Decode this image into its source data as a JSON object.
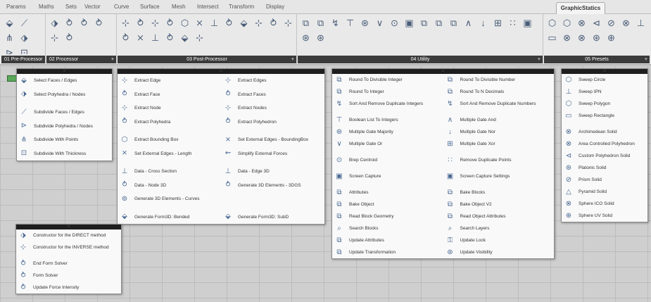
{
  "menubar": {
    "items": [
      "Params",
      "Maths",
      "Sets",
      "Vector",
      "Curve",
      "Surface",
      "Mesh",
      "Intersect",
      "Transform",
      "Display"
    ],
    "active_tab": "GraphicStatics"
  },
  "ribbon": {
    "groups": [
      {
        "label": "01 Pre-Processor",
        "icons": [
          "⬙",
          "⟋",
          "⋔",
          "⬗",
          "⊳",
          "⊡"
        ]
      },
      {
        "label": "02 Processor",
        "icons": [
          "⬗",
          "⥁",
          "⥁",
          "⥁",
          "⊹",
          "⥁"
        ]
      },
      {
        "label": "03 Post-Processor",
        "icons": [
          "⊹",
          "⥁",
          "⊹",
          "⥁",
          "⬡",
          "⨯",
          "⊥",
          "⥁",
          "⬙",
          "⊹",
          "⥁",
          "⊹",
          "⥁",
          "⨯",
          "⊥",
          "⥁",
          "⬙",
          "⊹"
        ]
      },
      {
        "label": "04 Utility",
        "icons": [
          "⧉",
          "⧉",
          "↯",
          "⊤",
          "⊛",
          "∨",
          "⊙",
          "▣",
          "⧉",
          "⧉",
          "⧉",
          "∧",
          "↓",
          "⊞",
          "∷",
          "▣",
          "⊛",
          "⊛"
        ]
      },
      {
        "label": "05 Presets",
        "icons": [
          "⬡",
          "⬡",
          "⊗",
          "⊲",
          "⊘",
          "⊗",
          "⊥",
          "▭",
          "⊗",
          "⊗",
          "⊛",
          "⊕"
        ]
      }
    ]
  },
  "menu1": {
    "items": [
      "Select Faces / Edges",
      "Select Polyhedra / Nodes",
      "",
      "Subdivide Faces / Edges",
      "Subdivide Polyhedra / Nodes",
      "Subdivide With Points",
      "Subdivide With Thickness"
    ]
  },
  "menu2": {
    "left": [
      "Extract Edge",
      "Extract Face",
      "Extract Node",
      "Extract Polyhedra",
      "",
      "Extract Bounding Box",
      "Set External Edges - Length",
      "",
      "Data - Cross Section",
      "Data - Node 3D",
      "Generate 3D Elements - Curves",
      "",
      "Generate Form3D: Bended"
    ],
    "right": [
      "Extract Edges",
      "Extract Faces",
      "Extract Nodes",
      "Extract Polyhedron",
      "",
      "Set External Edges - BoundingBox",
      "Simplify External Forces",
      "",
      "Data - Edge 3D",
      "Generate 3D Elements - 3DGS",
      "",
      "",
      "Generate Form3D: SubD"
    ]
  },
  "menu3": {
    "left": [
      "Round To Divisible Integer",
      "Round To Integer",
      "Sort And Remove Duplicate Integers",
      "",
      "Boolean List To Integers",
      "Multiple Gate Majority",
      "Multiple Gate Or",
      "",
      "Brep Centroid",
      "",
      "Screen Capture",
      "",
      "Attributes",
      "Bake Object",
      "Read Block Geometry",
      "Search Blocks",
      "Update Attributes",
      "Update Transformation"
    ],
    "right": [
      "Round To Divisible Number",
      "Round To N Decimals",
      "Sort And Remove Duplicate Numbers",
      "",
      "Multiple Gate And",
      "Multiple Gate Nor",
      "Multiple Gate Xor",
      "",
      "Remove Duplicate Points",
      "",
      "Screen Capture Settings",
      "",
      "Bake Blocks",
      "Bake Object V2",
      "Read Object Attributes",
      "Search Layers",
      "Update Lock",
      "Update Visibility"
    ]
  },
  "menu4": {
    "items": [
      "Sweep Circle",
      "Sweep IPN",
      "Sweep Polygon",
      "Sweep Rectangle",
      "",
      "Archimedean Solid",
      "Area Controlled Polyhedron",
      "Custom Polyhedron Solid",
      "Platonic Solid",
      "Prism Solid",
      "Pyramid Solid",
      "Sphere ICO Solid",
      "Sphere UV Solid"
    ]
  },
  "menu5": {
    "items": [
      "Constructor for the DIRECT method",
      "Constructor for the INVERSE method",
      "",
      "End Form Solver",
      "Form Solver",
      "Update Force Intensity"
    ]
  }
}
